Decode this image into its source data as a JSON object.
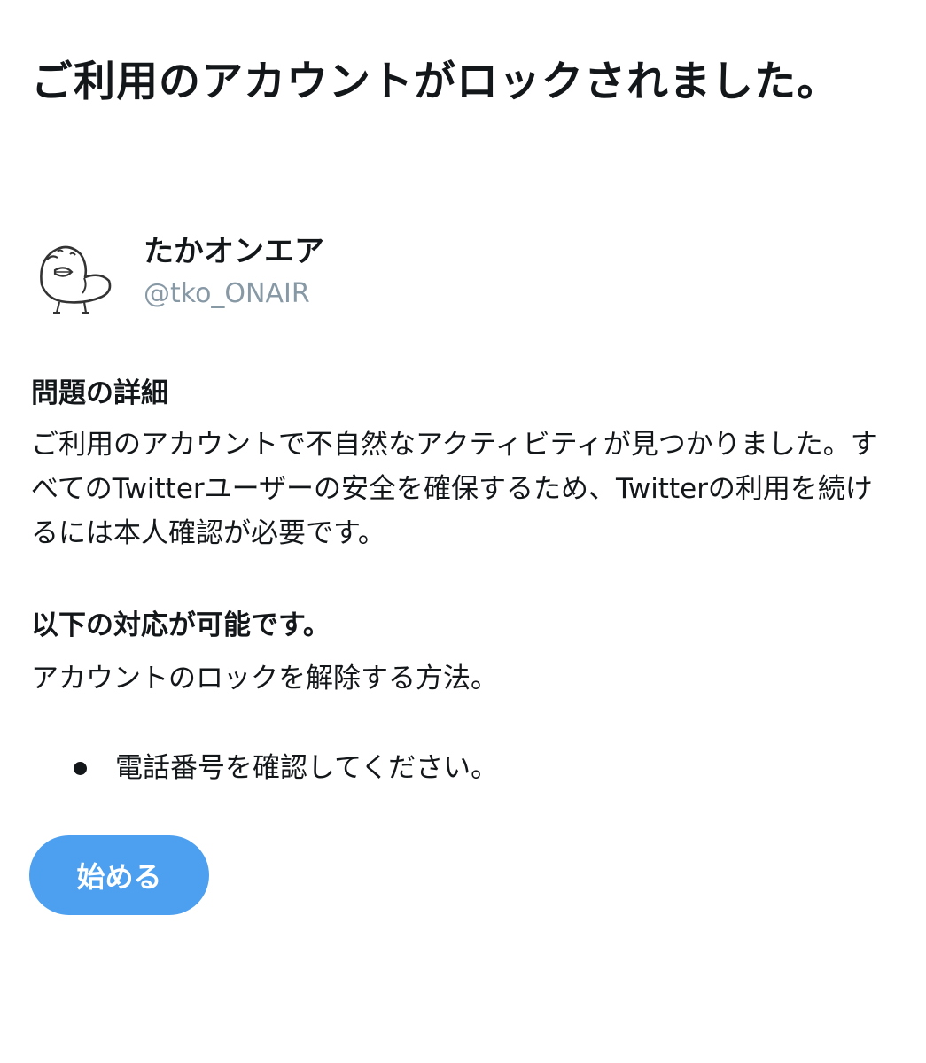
{
  "title": "ご利用のアカウントがロックされました。",
  "account": {
    "display_name": "たかオンエア",
    "handle": "@tko_ONAIR",
    "avatar_icon": "chick-illustration-avatar"
  },
  "problem": {
    "heading": "問題の詳細",
    "body": "ご利用のアカウントで不自然なアクティビティが見つかりました。すべてのTwitterユーザーの安全を確保するため、Twitterの利用を続けるには本人確認が必要です。"
  },
  "options": {
    "heading": "以下の対応が可能です。",
    "subtext": "アカウントのロックを解除する方法。",
    "items": [
      {
        "label": "電話番号を確認してください。"
      }
    ]
  },
  "start_button": {
    "label": "始める"
  },
  "colors": {
    "text": "#14171a",
    "muted": "#8899a6",
    "button": "#4d9ff0",
    "button_text": "#ffffff"
  }
}
